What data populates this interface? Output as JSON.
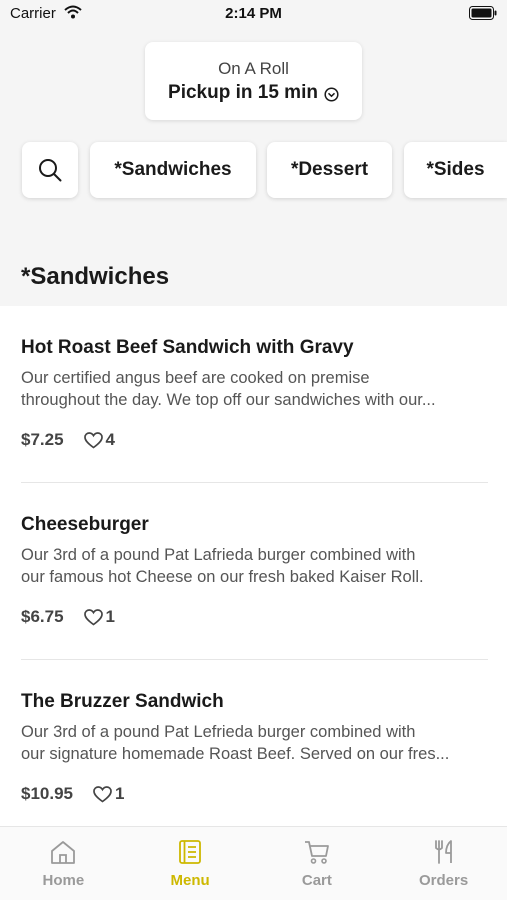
{
  "status_bar": {
    "carrier": "Carrier",
    "time": "2:14 PM"
  },
  "header": {
    "store_name": "On A Roll",
    "pickup": "Pickup in 15 min"
  },
  "categories": [
    "*Sandwiches",
    "*Dessert",
    "*Sides"
  ],
  "section": {
    "title": "*Sandwiches"
  },
  "items": [
    {
      "name": "Hot Roast Beef Sandwich with Gravy",
      "desc_line1": "Our certified angus beef are cooked on premise",
      "desc_line2": "throughout the day. We top off our sandwiches with our...",
      "price": "$7.25",
      "likes": "4"
    },
    {
      "name": "Cheeseburger",
      "desc_line1": "Our 3rd of a pound Pat Lafrieda burger combined with",
      "desc_line2": "our famous hot Cheese on our fresh baked Kaiser Roll.",
      "price": "$6.75",
      "likes": "1"
    },
    {
      "name": "The Bruzzer Sandwich",
      "desc_line1": "Our 3rd of a pound Pat Lefrieda burger combined with",
      "desc_line2": "our signature homemade Roast Beef. Served on our fres...",
      "price": "$10.95",
      "likes": "1"
    }
  ],
  "tabs": [
    {
      "label": "Home",
      "icon": "home-icon"
    },
    {
      "label": "Menu",
      "icon": "menu-icon"
    },
    {
      "label": "Cart",
      "icon": "cart-icon"
    },
    {
      "label": "Orders",
      "icon": "orders-icon"
    }
  ],
  "colors": {
    "accent": "#cdb800",
    "inactive": "#9a9a9a",
    "background": "#f5f5f5"
  }
}
